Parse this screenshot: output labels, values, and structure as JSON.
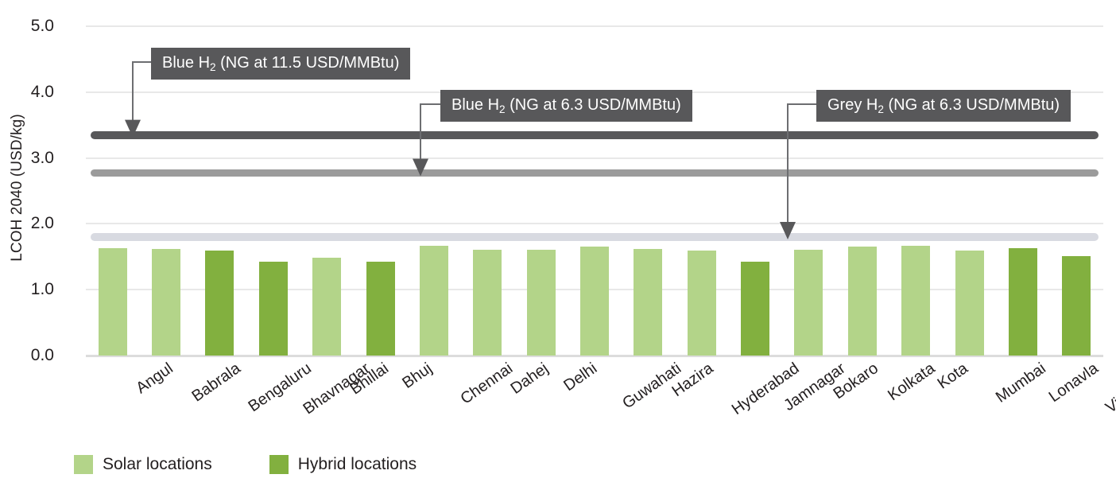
{
  "chart_data": {
    "type": "bar",
    "title": "",
    "xlabel": "",
    "ylabel": "LCOH 2040 (USD/kg)",
    "ylim": [
      0.0,
      5.0
    ],
    "ytick_labels": [
      "0.0",
      "1.0",
      "2.0",
      "3.0",
      "4.0",
      "5.0"
    ],
    "ytick_values": [
      0.0,
      1.0,
      2.0,
      3.0,
      4.0,
      5.0
    ],
    "grid": true,
    "legend_position": "bottom-left",
    "categories": [
      "Angul",
      "Babrala",
      "Bengaluru",
      "Bhavnagar",
      "Bhillai",
      "Bhuj",
      "Chennai",
      "Dahej",
      "Delhi",
      "Guwahati",
      "Hazira",
      "Hyderabad",
      "Jamnagar",
      "Bokaro",
      "Kolkata",
      "Kota",
      "Mumbai",
      "Lonavla",
      "Vijaynagar"
    ],
    "values": [
      1.63,
      1.62,
      1.6,
      1.43,
      1.49,
      1.42,
      1.67,
      1.61,
      1.61,
      1.65,
      1.62,
      1.6,
      1.42,
      1.61,
      1.66,
      1.67,
      1.6,
      1.63,
      1.51
    ],
    "bar_types": [
      "solar",
      "solar",
      "hybrid",
      "hybrid",
      "solar",
      "hybrid",
      "solar",
      "solar",
      "solar",
      "solar",
      "solar",
      "solar",
      "hybrid",
      "solar",
      "solar",
      "solar",
      "solar",
      "hybrid",
      "hybrid"
    ],
    "reference_lines": [
      {
        "key": "blue115",
        "label": "Blue H",
        "sub": "2",
        "label_rest": " (NG at 11.5 USD/MMBtu)",
        "value": 3.35,
        "color": "#58585a"
      },
      {
        "key": "blue63",
        "label": "Blue H",
        "sub": "2",
        "label_rest": " (NG at 6.3 USD/MMBtu)",
        "value": 2.76,
        "color": "#9b9b9b"
      },
      {
        "key": "grey63",
        "label": "Grey H",
        "sub": "2",
        "label_rest": " (NG at 6.3 USD/MMBtu)",
        "value": 1.8,
        "color": "#d8dae1"
      }
    ],
    "legend": [
      {
        "key": "solar",
        "label": "Solar locations",
        "color": "#b3d489"
      },
      {
        "key": "hybrid",
        "label": "Hybrid locations",
        "color": "#82b03f"
      }
    ]
  }
}
